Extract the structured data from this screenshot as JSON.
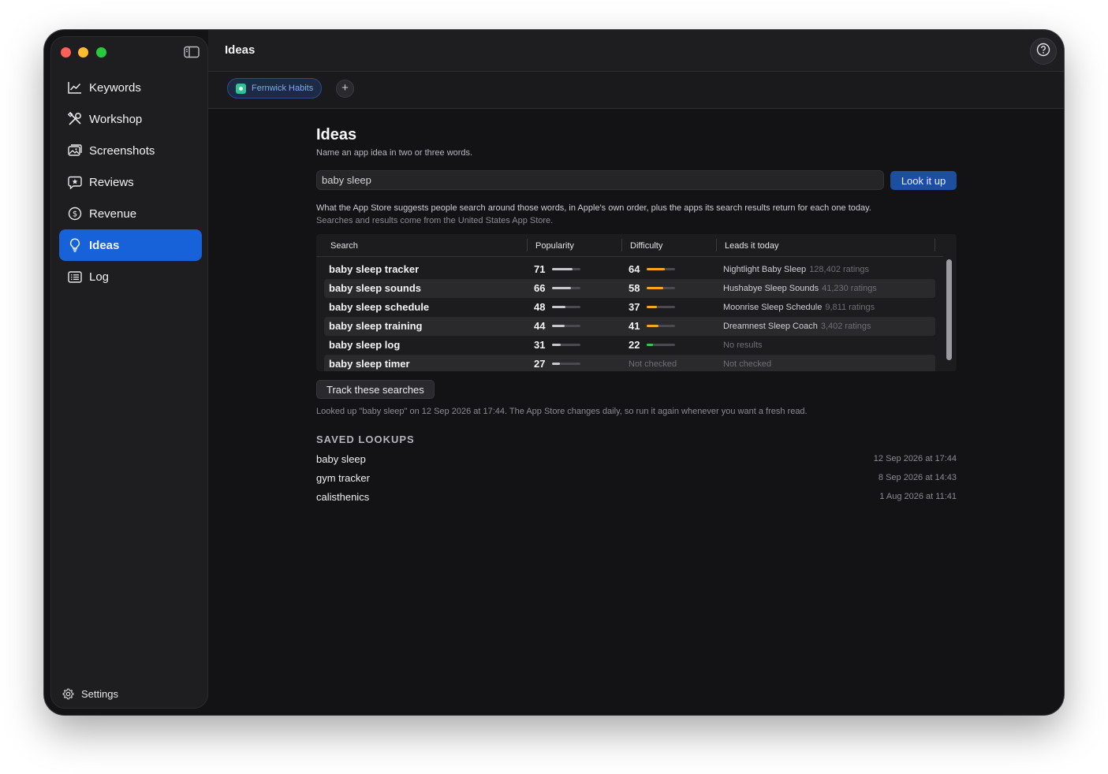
{
  "window": {
    "title": "Ideas"
  },
  "sidebar": {
    "items": [
      {
        "label": "Keywords",
        "icon": "chart-line-icon"
      },
      {
        "label": "Workshop",
        "icon": "tools-icon"
      },
      {
        "label": "Screenshots",
        "icon": "images-icon"
      },
      {
        "label": "Reviews",
        "icon": "star-bubble-icon"
      },
      {
        "label": "Revenue",
        "icon": "dollar-circle-icon"
      },
      {
        "label": "Ideas",
        "icon": "lightbulb-icon",
        "active": true
      },
      {
        "label": "Log",
        "icon": "list-icon"
      }
    ],
    "settings_label": "Settings"
  },
  "tabs": {
    "app_name": "Fernwick Habits",
    "add_label": "+"
  },
  "page": {
    "title": "Ideas",
    "subtitle": "Name an app idea in two or three words.",
    "search_value": "baby sleep",
    "lookup_button": "Look it up",
    "explanation": "What the App Store suggests people search around those words, in Apple's own order, plus the apps its search results return for each one today.",
    "source_note": "Searches and results come from the United States App Store."
  },
  "table": {
    "headers": {
      "search": "Search",
      "popularity": "Popularity",
      "difficulty": "Difficulty",
      "leads": "Leads it today"
    },
    "rows": [
      {
        "term": "baby sleep tracker",
        "popularity": "71",
        "difficulty": "64",
        "leader": "Nightlight Baby Sleep",
        "ratings": "128,402 ratings"
      },
      {
        "term": "baby sleep sounds",
        "popularity": "66",
        "difficulty": "58",
        "leader": "Hushabye Sleep Sounds",
        "ratings": "41,230 ratings"
      },
      {
        "term": "baby sleep schedule",
        "popularity": "48",
        "difficulty": "37",
        "leader": "Moonrise Sleep Schedule",
        "ratings": "9,811 ratings"
      },
      {
        "term": "baby sleep training",
        "popularity": "44",
        "difficulty": "41",
        "leader": "Dreamnest Sleep Coach",
        "ratings": "3,402 ratings"
      },
      {
        "term": "baby sleep log",
        "popularity": "31",
        "difficulty": "22",
        "leader": "",
        "ratings": "",
        "leader_status": "No results"
      },
      {
        "term": "baby sleep timer",
        "popularity": "27",
        "difficulty": null,
        "difficulty_status": "Not checked",
        "leader": "",
        "ratings": "",
        "leader_status": "Not checked"
      }
    ]
  },
  "track_button": "Track these searches",
  "lookup_note": "Looked up \"baby sleep\" on 12 Sep 2026 at 17:44. The App Store changes daily, so run it again whenever you want a fresh read.",
  "saved": {
    "heading": "SAVED LOOKUPS",
    "items": [
      {
        "term": "baby sleep",
        "date": "12 Sep 2026 at 17:44"
      },
      {
        "term": "gym tracker",
        "date": "8 Sep 2026 at 14:43"
      },
      {
        "term": "calisthenics",
        "date": "1 Aug 2026 at 11:41"
      }
    ]
  },
  "colors": {
    "accent": "#1762d9",
    "difficulty_high": "#f5a623",
    "difficulty_low": "#34c759",
    "popularity_bar": "#c8c8cc"
  }
}
